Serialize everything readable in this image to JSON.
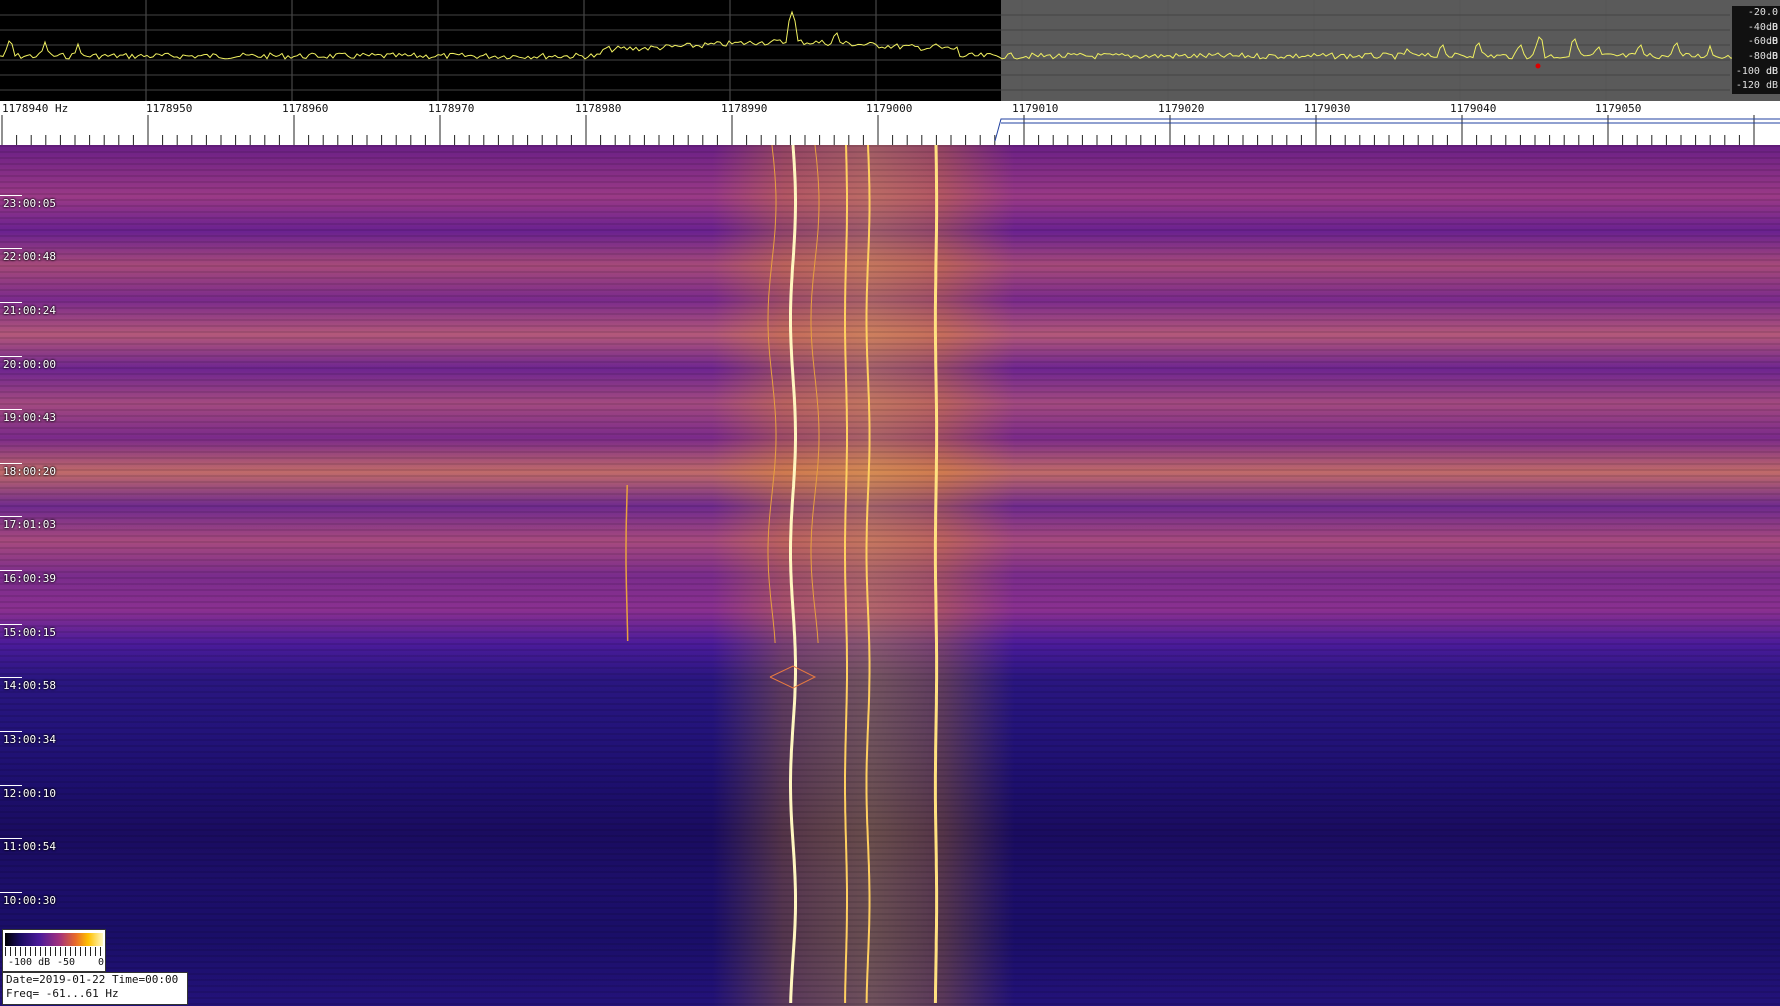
{
  "spectrum": {
    "db_labels": [
      "-20.0 dB",
      "-40.0 dB",
      "-60.0 dB",
      "-80.0 dB",
      "-100 dB",
      "-120 dB"
    ],
    "trace_color": "#f0f060",
    "background_color": "#000000",
    "shade_color": "#5a5a5a"
  },
  "ruler": {
    "freq_labels": [
      "1178940 Hz",
      "1178950",
      "1178960",
      "1178970",
      "1178980",
      "1178990",
      "1179000",
      "1179010",
      "1179020",
      "1179030",
      "1179040",
      "1179050"
    ]
  },
  "waterfall": {
    "time_labels": [
      "23:00:05",
      "22:00:48",
      "21:00:24",
      "20:00:00",
      "19:00:43",
      "18:00:20",
      "17:01:03",
      "16:00:39",
      "15:00:15",
      "14:00:58",
      "13:00:34",
      "12:00:10",
      "11:00:54",
      "10:00:30"
    ],
    "colormap": [
      "#000000",
      "#1a0c60",
      "#4a1b9a",
      "#a0307e",
      "#e86a2a",
      "#ffc000",
      "#fff8c0"
    ]
  },
  "colorbar": {
    "labels": [
      "-100 dB",
      "-50",
      "0"
    ]
  },
  "info": {
    "date_line": "Date=2019-01-22 Time=00:00",
    "freq_line": "Freq= -61...61 Hz"
  }
}
